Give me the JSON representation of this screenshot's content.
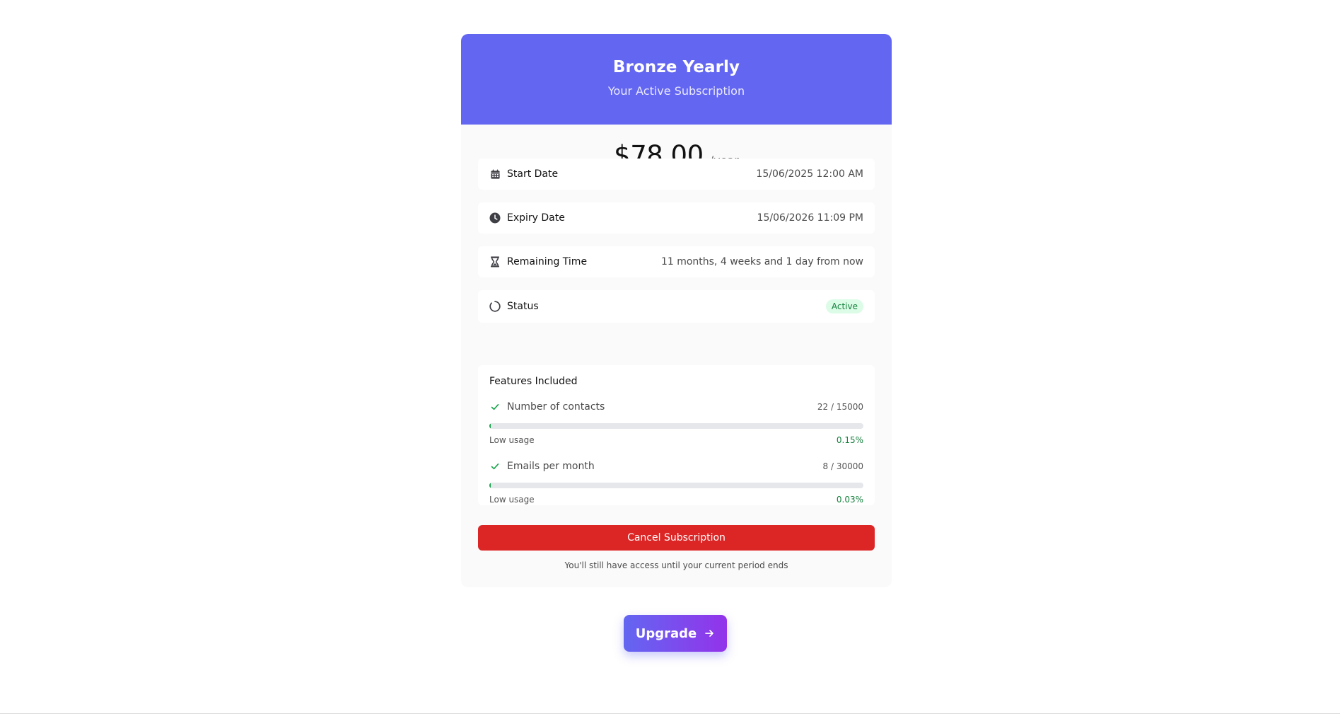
{
  "plan": {
    "name": "Bronze Yearly",
    "subtitle": "Your Active Subscription",
    "price": "$78.00",
    "period": "/year"
  },
  "details": {
    "start": {
      "label": "Start Date",
      "value": "15/06/2025 12:00 AM",
      "icon": "calendar-icon"
    },
    "expiry": {
      "label": "Expiry Date",
      "value": "15/06/2026 11:09 PM",
      "icon": "clock-icon"
    },
    "remaining": {
      "label": "Remaining Time",
      "value": "11 months, 4 weeks and 1 day from now",
      "icon": "hourglass-icon"
    },
    "status": {
      "label": "Status",
      "value": "Active",
      "icon": "circle-status-icon"
    }
  },
  "features": {
    "title": "Features Included",
    "items": [
      {
        "name": "Number of contacts",
        "count": "22 / 15000",
        "usage_label": "Low usage",
        "usage_percent": "0.15%",
        "fill_percent": 0.15
      },
      {
        "name": "Emails per month",
        "count": "8 / 30000",
        "usage_label": "Low usage",
        "usage_percent": "0.03%",
        "fill_percent": 0.03
      }
    ]
  },
  "actions": {
    "cancel_label": "Cancel Subscription",
    "cancel_note": "You'll still have access until your current period ends",
    "upgrade_label": "Upgrade"
  },
  "colors": {
    "header": "#6366f1",
    "cancel": "#dc2626",
    "success": "#16a34a",
    "upgrade_start": "#6366f1",
    "upgrade_end": "#9333ea"
  }
}
